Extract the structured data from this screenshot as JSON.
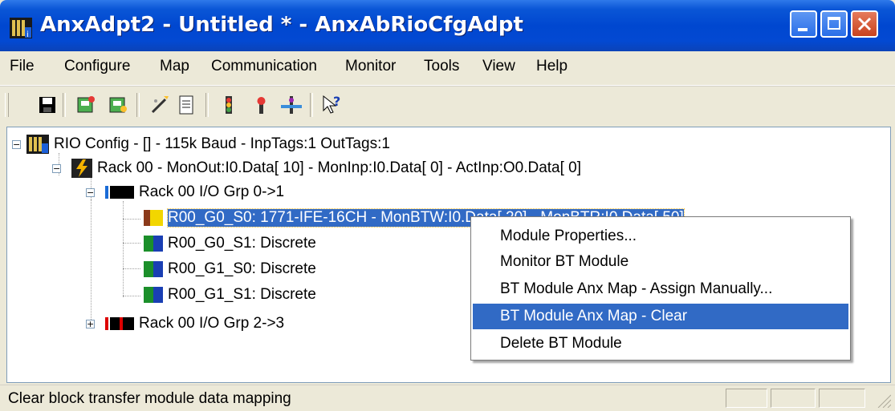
{
  "window": {
    "title": "AnxAdpt2 - Untitled * - AnxAbRioCfgAdpt"
  },
  "menubar": {
    "items": [
      {
        "label": "File"
      },
      {
        "label": "Configure"
      },
      {
        "label": "Map"
      },
      {
        "label": "Communication"
      },
      {
        "label": "Monitor"
      },
      {
        "label": "Tools"
      },
      {
        "label": "View"
      },
      {
        "label": "Help"
      }
    ]
  },
  "toolbar": {
    "icons": [
      "save-icon",
      "read-config-icon",
      "write-config-icon",
      "wizard-icon",
      "report-icon",
      "go-online-icon",
      "go-offline-icon",
      "monitor-icon",
      "help-pointer-icon"
    ]
  },
  "tree": {
    "root": "RIO Config - [] - 115k Baud - InpTags:1 OutTags:1",
    "rack": "Rack 00 - MonOut:I0.Data[ 10] - MonInp:I0.Data[  0] - ActInp:O0.Data[  0]",
    "group1": "Rack 00 I/O Grp 0->1",
    "modules": [
      {
        "label": "R00_G0_S0: 1771-IFE-16CH - MonBTW:I0.Data[ 20] - MonBTR:I0.Data[ 50]"
      },
      {
        "label": "R00_G0_S1: Discrete"
      },
      {
        "label": "R00_G1_S0: Discrete"
      },
      {
        "label": "R00_G1_S1: Discrete"
      }
    ],
    "group2": "Rack 00 I/O Grp 2->3"
  },
  "context_menu": {
    "items": [
      {
        "label": "Module Properties..."
      },
      {
        "label": "Monitor BT Module"
      },
      {
        "label": "BT Module Anx Map - Assign Manually..."
      },
      {
        "label": "BT Module Anx Map - Clear"
      },
      {
        "label": "Delete BT Module"
      }
    ]
  },
  "statusbar": {
    "text": "Clear block transfer module data mapping"
  },
  "colors": {
    "selection": "#316ac5",
    "titlebar": "#0047d0"
  }
}
